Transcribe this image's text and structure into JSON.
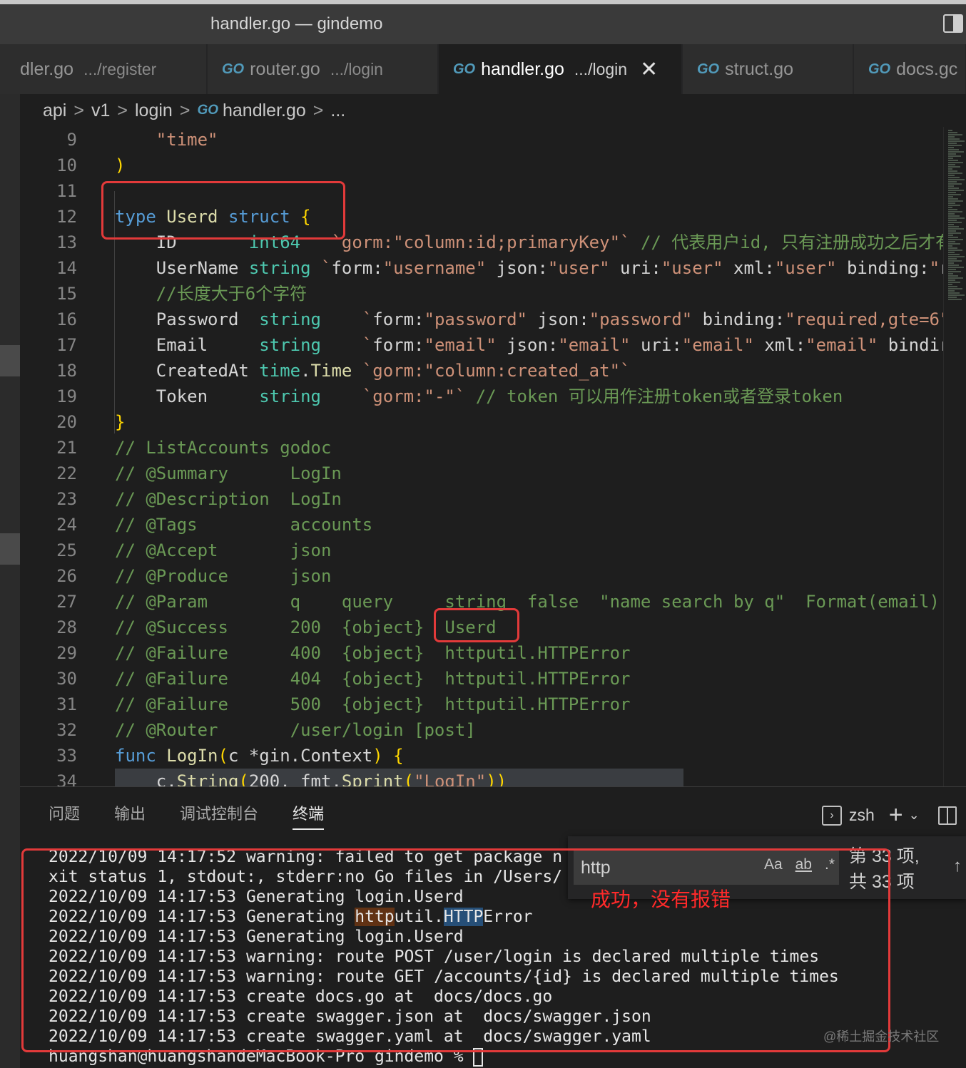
{
  "window": {
    "title": "handler.go — gindemo"
  },
  "tabs": [
    {
      "go": "",
      "name": "dler.go",
      "dir": ".../register"
    },
    {
      "go": "GO",
      "name": "router.go",
      "dir": ".../login"
    },
    {
      "go": "GO",
      "name": "handler.go",
      "dir": ".../login",
      "close": "✕"
    },
    {
      "go": "GO",
      "name": "struct.go",
      "dir": ""
    },
    {
      "go": "GO",
      "name": "docs.gc",
      "dir": ""
    }
  ],
  "breadcrumb": {
    "items": [
      "api",
      "v1",
      "login"
    ],
    "go": "GO",
    "file": "handler.go",
    "more": "...",
    "sep": ">"
  },
  "editor": {
    "lines": [
      {
        "n": "9",
        "c": "    \"time\""
      },
      {
        "n": "10",
        "c": ")"
      },
      {
        "n": "11",
        "c": ""
      },
      {
        "n": "12",
        "c": "type Userd struct {"
      },
      {
        "n": "13",
        "c": "    ID       int64   `gorm:\"column:id;primaryKey\"` // 代表用户id, 只有注册成功之后才有"
      },
      {
        "n": "14",
        "c": "    UserName string `form:\"username\" json:\"user\" uri:\"user\" xml:\"user\" binding:\"r"
      },
      {
        "n": "15",
        "c": "    //长度大于6个字符"
      },
      {
        "n": "16",
        "c": "    Password  string    `form:\"password\" json:\"password\" binding:\"required,gte=6\""
      },
      {
        "n": "17",
        "c": "    Email     string    `form:\"email\" json:\"email\" uri:\"email\" xml:\"email\" bindir"
      },
      {
        "n": "18",
        "c": "    CreatedAt time.Time `gorm:\"column:created_at\"`"
      },
      {
        "n": "19",
        "c": "    Token     string    `gorm:\"-\"` // token 可以用作注册token或者登录token"
      },
      {
        "n": "20",
        "c": "}"
      },
      {
        "n": "21",
        "c": "// ListAccounts godoc"
      },
      {
        "n": "22",
        "c": "// @Summary      LogIn"
      },
      {
        "n": "23",
        "c": "// @Description  LogIn"
      },
      {
        "n": "24",
        "c": "// @Tags         accounts"
      },
      {
        "n": "25",
        "c": "// @Accept       json"
      },
      {
        "n": "26",
        "c": "// @Produce      json"
      },
      {
        "n": "27",
        "c": "// @Param        q    query     string  false  \"name search by q\"  Format(email)"
      },
      {
        "n": "28",
        "c": "// @Success      200  {object}  Userd"
      },
      {
        "n": "29",
        "c": "// @Failure      400  {object}  httputil.HTTPError"
      },
      {
        "n": "30",
        "c": "// @Failure      404  {object}  httputil.HTTPError"
      },
      {
        "n": "31",
        "c": "// @Failure      500  {object}  httputil.HTTPError"
      },
      {
        "n": "32",
        "c": "// @Router       /user/login [post]"
      },
      {
        "n": "33",
        "c": "func LogIn(c *gin.Context) {"
      },
      {
        "n": "34",
        "c": "    c.String(200, fmt.Sprint(\"LogIn\"))"
      }
    ]
  },
  "panel": {
    "tabs": [
      "问题",
      "输出",
      "调试控制台",
      "终端"
    ],
    "active_tab": "终端",
    "shell": "zsh",
    "add_icon": "+",
    "dropdown_icon": "⌄"
  },
  "terminal": {
    "lines": [
      "2022/10/09 14:17:52 warning: failed to get package n",
      "xit status 1, stdout:, stderr:no Go files in /Users/",
      "2022/10/09 14:17:53 Generating login.Userd",
      "2022/10/09 14:17:53 Generating httputil.HTTPError",
      "2022/10/09 14:17:53 Generating login.Userd",
      "2022/10/09 14:17:53 warning: route POST /user/login is declared multiple times",
      "2022/10/09 14:17:53 warning: route GET /accounts/{id} is declared multiple times",
      "2022/10/09 14:17:53 create docs.go at  docs/docs.go",
      "2022/10/09 14:17:53 create swagger.json at  docs/swagger.json",
      "2022/10/09 14:17:53 create swagger.yaml at  docs/swagger.yaml"
    ],
    "prompt": "huangshan@huangshandeMacBook-Pro gindemo % "
  },
  "find": {
    "value": "http",
    "opt_case": "Aa",
    "opt_word": "ab",
    "opt_regex": ".*",
    "count_line1": "第 33 项,",
    "count_line2": "共 33 项",
    "up_icon": "↑"
  },
  "annotation": {
    "text": "成功，没有报错",
    "color": "#ff2a2a"
  },
  "watermark": "@稀土掘金技术社区"
}
